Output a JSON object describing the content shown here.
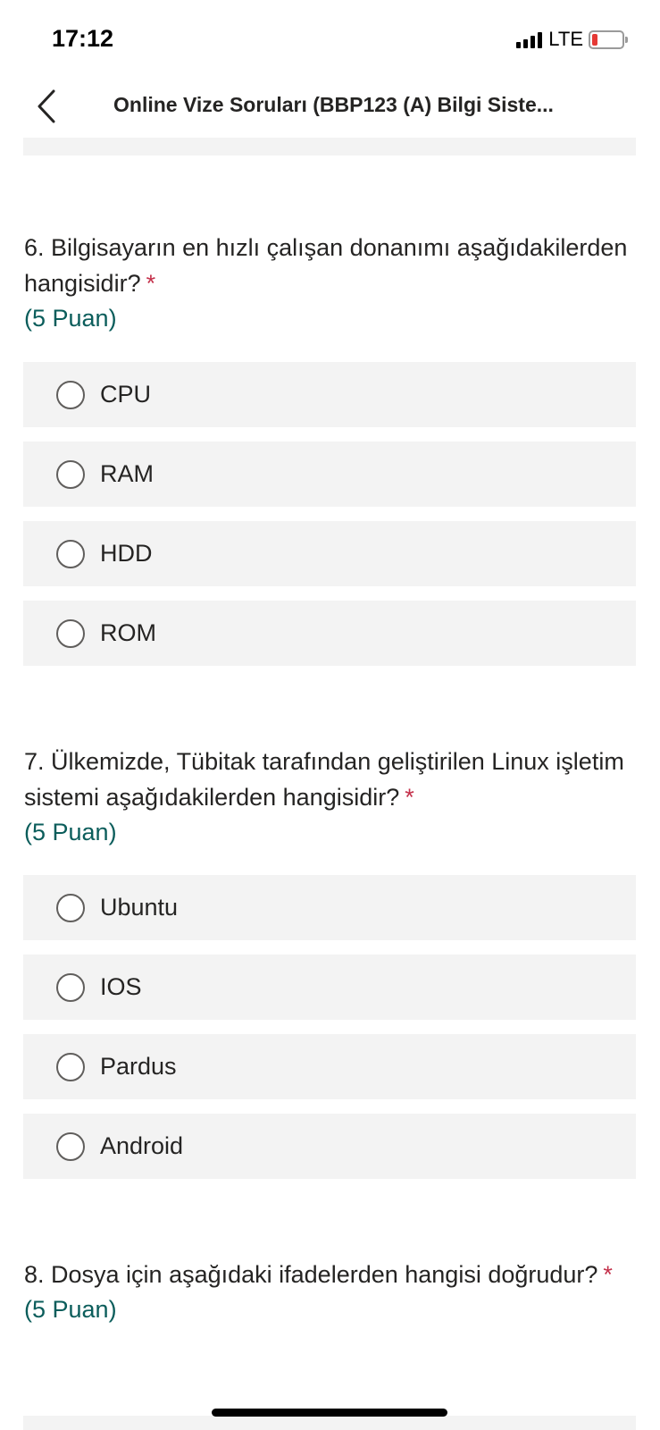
{
  "status": {
    "time": "17:12",
    "network": "LTE",
    "signal_icon": "cellular-signal-icon",
    "battery_icon": "battery-low-icon",
    "battery_color": "#e53935",
    "battery_level": 0.15
  },
  "nav": {
    "back_icon": "chevron-left-icon",
    "title": "Online Vize Soruları (BBP123 (A) Bilgi Siste..."
  },
  "colors": {
    "accent_teal": "#0b5d5b",
    "required_red": "#c4314b",
    "option_bg": "#f3f3f3"
  },
  "questions": [
    {
      "text": "6. Bilgisayarın en hızlı çalışan donanımı aşağıdakilerden hangisidir?",
      "required_mark": "*",
      "points": "(5 Puan)",
      "options": [
        {
          "label": "CPU"
        },
        {
          "label": "RAM"
        },
        {
          "label": "HDD"
        },
        {
          "label": "ROM"
        }
      ]
    },
    {
      "text": "7. Ülkemizde, Tübitak tarafından geliştirilen Linux işletim sistemi aşağıdakilerden hangisidir?",
      "required_mark": "*",
      "points": "(5 Puan)",
      "options": [
        {
          "label": "Ubuntu"
        },
        {
          "label": "IOS"
        },
        {
          "label": "Pardus"
        },
        {
          "label": "Android"
        }
      ]
    },
    {
      "text": "8. Dosya için aşağıdaki ifadelerden hangisi doğrudur?",
      "required_mark": "*",
      "points": "(5 Puan)",
      "options": []
    }
  ]
}
